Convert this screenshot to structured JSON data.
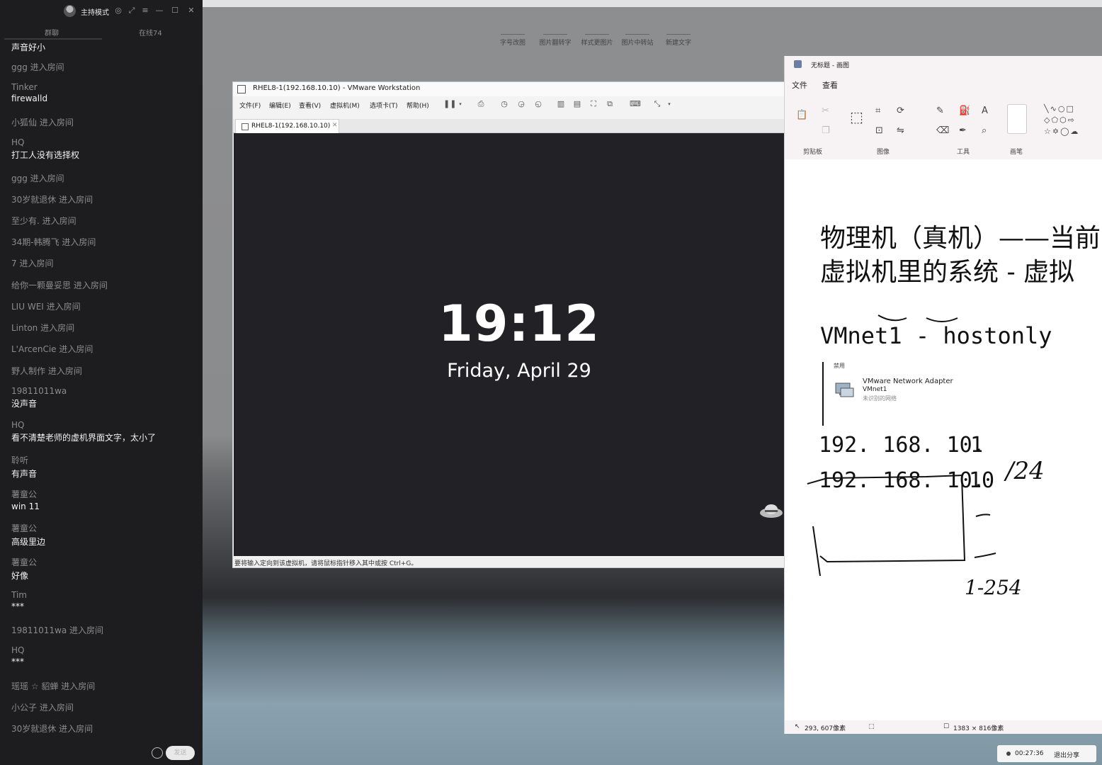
{
  "chat_panel": {
    "host_mode_label": "主持模式",
    "tabs": [
      {
        "label": "群聊"
      },
      {
        "label": "在线74"
      }
    ],
    "messages": [
      {
        "name": "",
        "text": "声音好小"
      },
      {
        "join": "ggg 进入房间"
      },
      {
        "name": "Tinker",
        "text": "firewalld"
      },
      {
        "join": "小狐仙 进入房间"
      },
      {
        "name": "HQ",
        "text": "打工人没有选择权"
      },
      {
        "join": "ggg 进入房间"
      },
      {
        "join": "30岁就退休 进入房间"
      },
      {
        "join": "至少有. 进入房间"
      },
      {
        "join": "34期-韩腾飞 进入房间"
      },
      {
        "join": "7 进入房间"
      },
      {
        "join": "给你一颗曼妥思 进入房间"
      },
      {
        "join": "LIU WEI 进入房间"
      },
      {
        "join": "Linton 进入房间"
      },
      {
        "join": "L'ArcenCie 进入房间"
      },
      {
        "join": "野人制作 进入房间"
      },
      {
        "name": "19811011wa",
        "text": "没声音"
      },
      {
        "name": "HQ",
        "text": "看不清楚老师的虚机界面文字，太小了"
      },
      {
        "name": "聆听",
        "text": "有声音"
      },
      {
        "name": "薯童公",
        "text": "win 11"
      },
      {
        "name": "薯童公",
        "text": "高级里边"
      },
      {
        "name": "薯童公",
        "text": "好像"
      },
      {
        "name": "Tim",
        "text": "***"
      },
      {
        "join": "19811011wa 进入房间"
      },
      {
        "name": "HQ",
        "text": "***"
      },
      {
        "join": "瑶瑶 ☆ 貂蝉 进入房间"
      },
      {
        "join": "小公子 进入房间"
      },
      {
        "join": "30岁就退休 进入房间"
      }
    ],
    "send_label": "发送"
  },
  "desktop_share_bar": {
    "items": [
      "字号改图",
      "图片翻转字",
      "样式更图片",
      "图片中转站",
      "新建文字"
    ]
  },
  "vmware": {
    "title": "RHEL8-1(192.168.10.10) - VMware Workstation",
    "menu": [
      "文件(F)",
      "编辑(E)",
      "查看(V)",
      "虚拟机(M)",
      "选项卡(T)",
      "帮助(H)"
    ],
    "tab_label": "RHEL8-1(192.168.10.10)",
    "lock_time": "19:12",
    "lock_date": "Friday, April 29",
    "status_text": "要将输入定向到该虚拟机，请将鼠标指针移入其中或按 Ctrl+G。"
  },
  "paint": {
    "title": "无标题 - 画图",
    "menu": [
      "文件",
      "查看"
    ],
    "groups": [
      "剪贴板",
      "图像",
      "工具",
      "画笔"
    ],
    "canvas": {
      "line1": "物理机（真机）——当前",
      "line2": "虚拟机里的系统 - 虚拟",
      "vmnet": "VMnet1 - hostonly",
      "adapter_sub": "禁用",
      "adapter_name": "VMware Network Adapter",
      "adapter_id": "VMnet1",
      "adapter_status": "未识别的网络",
      "ip1_prefix": "192. 168. 10.",
      "ip1_host": "1",
      "ip2_prefix": "192. 168. 10.",
      "ip2_host": "10",
      "mask": "/24",
      "range": "1-254"
    },
    "status": {
      "cursor_pos": "293, 607像素",
      "canvas_size": "1383 × 816像素"
    }
  },
  "recording": {
    "time": "00:27:36",
    "exit_label": "退出分享"
  }
}
